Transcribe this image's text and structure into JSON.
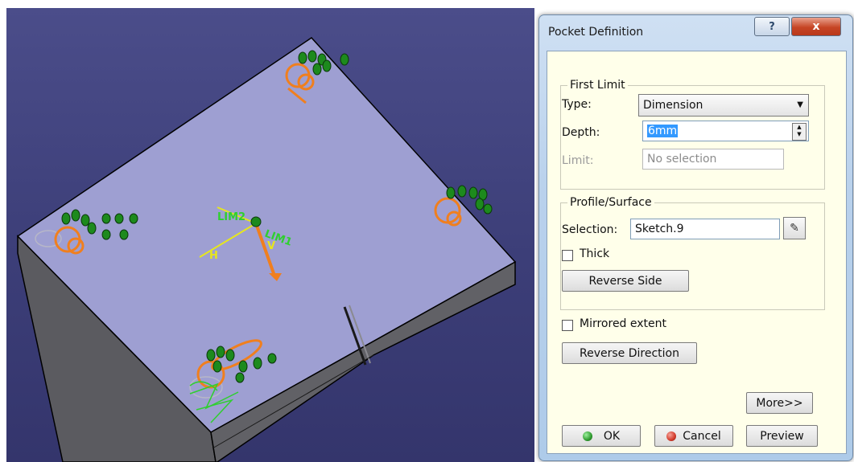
{
  "viewport": {
    "labels": {
      "lim2": "LIM2",
      "lim1": "LIM1",
      "h": "H",
      "v": "V"
    },
    "icons": {
      "axis": "axis-triad-icon",
      "constraints": "constraint-symbols-icon"
    }
  },
  "dialog": {
    "title": "Pocket Definition",
    "help_label": "?",
    "close_label": "x",
    "first_limit": {
      "legend": "First Limit",
      "type_label": "Type:",
      "type_value": "Dimension",
      "depth_label": "Depth:",
      "depth_value": "6mm",
      "limit_label": "Limit:",
      "limit_value": "No selection"
    },
    "profile": {
      "legend": "Profile/Surface",
      "selection_label": "Selection:",
      "selection_value": "Sketch.9",
      "sketch_icon": "sketch-edit-icon",
      "thick_label": "Thick",
      "thick_checked": false,
      "reverse_side_label": "Reverse Side"
    },
    "mirrored_label": "Mirrored extent",
    "mirrored_checked": false,
    "reverse_direction_label": "Reverse Direction",
    "more_label": "More>>",
    "ok_label": "OK",
    "cancel_label": "Cancel",
    "preview_label": "Preview",
    "colors": {
      "ok_dot": "#2e9a2e",
      "cancel_dot": "#d23a2a",
      "selection_highlight": "#3399ff"
    }
  }
}
